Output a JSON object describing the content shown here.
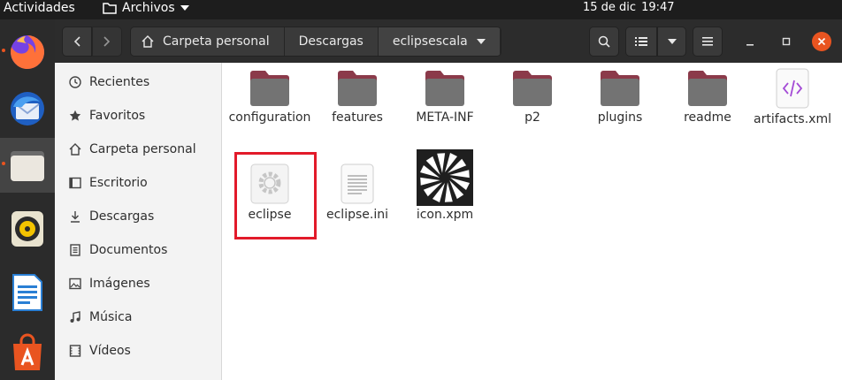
{
  "topbar": {
    "activities": "Actividades",
    "app_menu": "Archivos",
    "date": "15 de dic",
    "time": "19:47"
  },
  "dock": {
    "items": [
      {
        "name": "firefox",
        "color": "#ff7139"
      },
      {
        "name": "thunderbird",
        "color": "#2f7de1"
      },
      {
        "name": "files",
        "color": "#e8e2d8",
        "active": true
      },
      {
        "name": "rhythmbox",
        "color": "#f3c300"
      },
      {
        "name": "libreoffice-writer",
        "color": "#2a7fd4"
      },
      {
        "name": "software",
        "color": "#e95420"
      }
    ]
  },
  "path": {
    "crumbs": [
      "Carpeta personal",
      "Descargas",
      "eclipsescala"
    ]
  },
  "sidebar": {
    "items": [
      {
        "label": "Recientes",
        "icon": "clock-icon"
      },
      {
        "label": "Favoritos",
        "icon": "star-icon"
      },
      {
        "label": "Carpeta personal",
        "icon": "home-icon"
      },
      {
        "label": "Escritorio",
        "icon": "desktop-icon"
      },
      {
        "label": "Descargas",
        "icon": "download-icon"
      },
      {
        "label": "Documentos",
        "icon": "document-icon"
      },
      {
        "label": "Imágenes",
        "icon": "image-icon"
      },
      {
        "label": "Música",
        "icon": "music-icon"
      },
      {
        "label": "Vídeos",
        "icon": "video-icon"
      }
    ]
  },
  "files": [
    {
      "label": "configuration",
      "type": "folder"
    },
    {
      "label": "features",
      "type": "folder"
    },
    {
      "label": "META-INF",
      "type": "folder"
    },
    {
      "label": "p2",
      "type": "folder"
    },
    {
      "label": "plugins",
      "type": "folder"
    },
    {
      "label": "readme",
      "type": "folder"
    },
    {
      "label": "artifacts.xml",
      "type": "xml"
    },
    {
      "label": "eclipse",
      "type": "executable"
    },
    {
      "label": "eclipse.ini",
      "type": "text"
    },
    {
      "label": "icon.xpm",
      "type": "image"
    }
  ],
  "colors": {
    "accent": "#e95420",
    "folder_top": "#8b3a4a",
    "folder_body": "#737373",
    "selection": "#e21a2a"
  }
}
